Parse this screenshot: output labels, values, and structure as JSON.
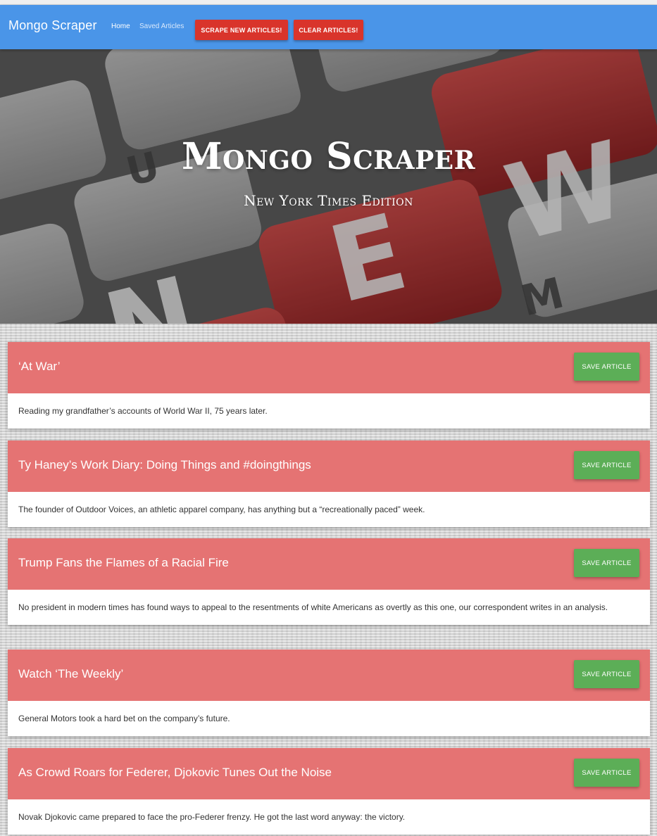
{
  "navbar": {
    "brand": "Mongo Scraper",
    "links": [
      "Home",
      "Saved Articles"
    ],
    "scrape_label": "Scrape New Articles!",
    "clear_label": "Clear Articles!"
  },
  "hero": {
    "title": "Mongo Scraper",
    "subtitle": "New York Times Edition",
    "keys": [
      "U",
      "N",
      "E",
      "W",
      "M"
    ]
  },
  "articles": [
    {
      "title": "‘At War’",
      "summary": "Reading my grandfather’s accounts of World War II, 75 years later.",
      "save_label": "Save Article"
    },
    {
      "title": "Ty Haney’s Work Diary: Doing Things and #doingthings",
      "summary": "The founder of Outdoor Voices, an athletic apparel company, has anything but a “recreationally paced” week.",
      "save_label": "Save Article"
    },
    {
      "title": "Trump Fans the Flames of a Racial Fire",
      "summary": "No president in modern times has found ways to appeal to the resentments of white Americans as overtly as this one, our correspondent writes in an analysis.",
      "save_label": "Save Article"
    },
    {
      "title": "Watch ‘The Weekly’",
      "summary": "General Motors took a hard bet on the company’s future.",
      "save_label": "Save Article"
    },
    {
      "title": "As Crowd Roars for Federer, Djokovic Tunes Out the Noise",
      "summary": "Novak Djokovic came prepared to face the pro-Federer frenzy. He got the last word anyway: the victory.",
      "save_label": "Save Article"
    }
  ],
  "colors": {
    "navbar": "#4a95e8",
    "nav_button": "#d9342b",
    "card_header": "#e57373",
    "save_button": "#5cae57"
  }
}
